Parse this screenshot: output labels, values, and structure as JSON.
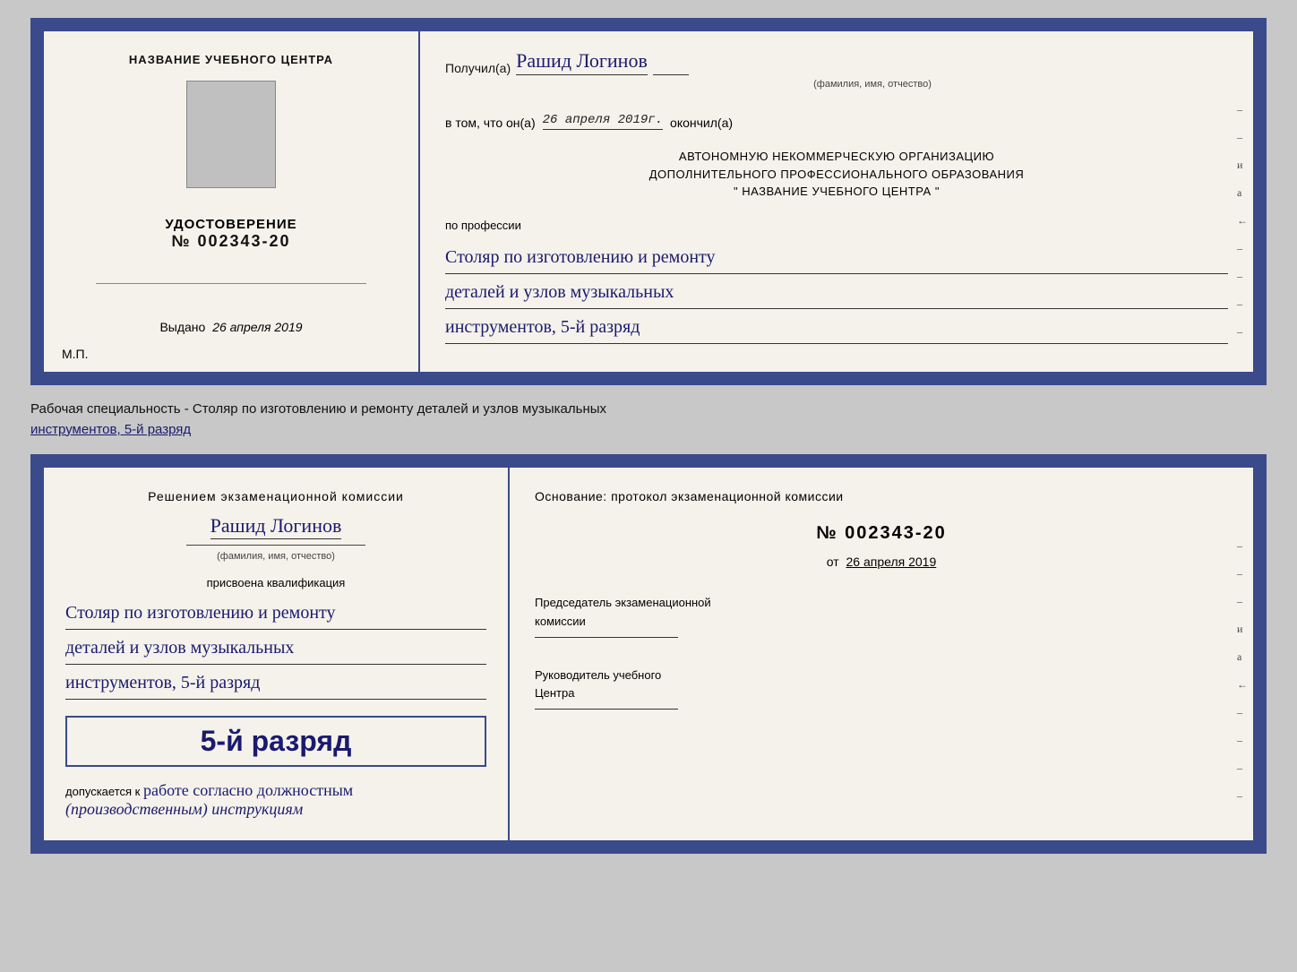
{
  "topCert": {
    "leftPanel": {
      "title": "НАЗВАНИЕ УЧЕБНОГО ЦЕНТРА",
      "udostoverenie": "УДОСТОВЕРЕНИЕ",
      "number": "№ 002343-20",
      "vydano": "Выдано",
      "vydanoDate": "26 апреля 2019",
      "mp": "М.П."
    },
    "rightPanel": {
      "poluchilLabel": "Получил(а)",
      "name": "Рашид Логинов",
      "nameSubLabel": "(фамилия, имя, отчество)",
      "dash": "–",
      "vtomLabel": "в том, что он(а)",
      "date": "26 апреля 2019г.",
      "okonchhilLabel": "окончил(а)",
      "orgLine1": "АВТОНОМНУЮ НЕКОММЕРЧЕСКУЮ ОРГАНИЗАЦИЮ",
      "orgLine2": "ДОПОЛНИТЕЛЬНОГО ПРОФЕССИОНАЛЬНОГО ОБРАЗОВАНИЯ",
      "orgLine3": "\"   НАЗВАНИЕ УЧЕБНОГО ЦЕНТРА   \"",
      "poLabel": "по профессии",
      "profession1": "Столяр по изготовлению и ремонту",
      "profession2": "деталей и узлов музыкальных",
      "profession3": "инструментов, 5-й разряд",
      "sideChars": [
        "–",
        "–",
        "и",
        "а",
        "←",
        "–",
        "–",
        "–",
        "–"
      ]
    }
  },
  "middleText": {
    "line1": "Рабочая специальность - Столяр по изготовлению и ремонту деталей и узлов музыкальных",
    "line2": "инструментов, 5-й разряд"
  },
  "bottomCert": {
    "leftPanel": {
      "resheniemTitle": "Решением  экзаменационной  комиссии",
      "name": "Рашид Логинов",
      "nameSubLabel": "(фамилия, имя, отчество)",
      "prisvoenaLabel": "присвоена квалификация",
      "profession1": "Столяр по изготовлению и ремонту",
      "profession2": "деталей и узлов музыкальных",
      "profession3": "инструментов, 5-й разряд",
      "rankText": "5-й разряд",
      "dopuskaetsyaLabel": "допускается к",
      "dopuskaetsyaText": "работе согласно должностным",
      "dopuskaetsyaText2": "(производственным) инструкциям"
    },
    "rightPanel": {
      "osnovanie": "Основание: протокол экзаменационной  комиссии",
      "numberLabel": "№ 002343-20",
      "otLabel": "от",
      "otDate": "26 апреля 2019",
      "predsedatelLabel": "Председатель экзаменационной",
      "predsedatelLabel2": "комиссии",
      "rukovoditelLabel": "Руководитель учебного",
      "rukovoditelLabel2": "Центра",
      "sideChars": [
        "–",
        "–",
        "–",
        "и",
        "а",
        "←",
        "–",
        "–",
        "–",
        "–"
      ]
    }
  }
}
